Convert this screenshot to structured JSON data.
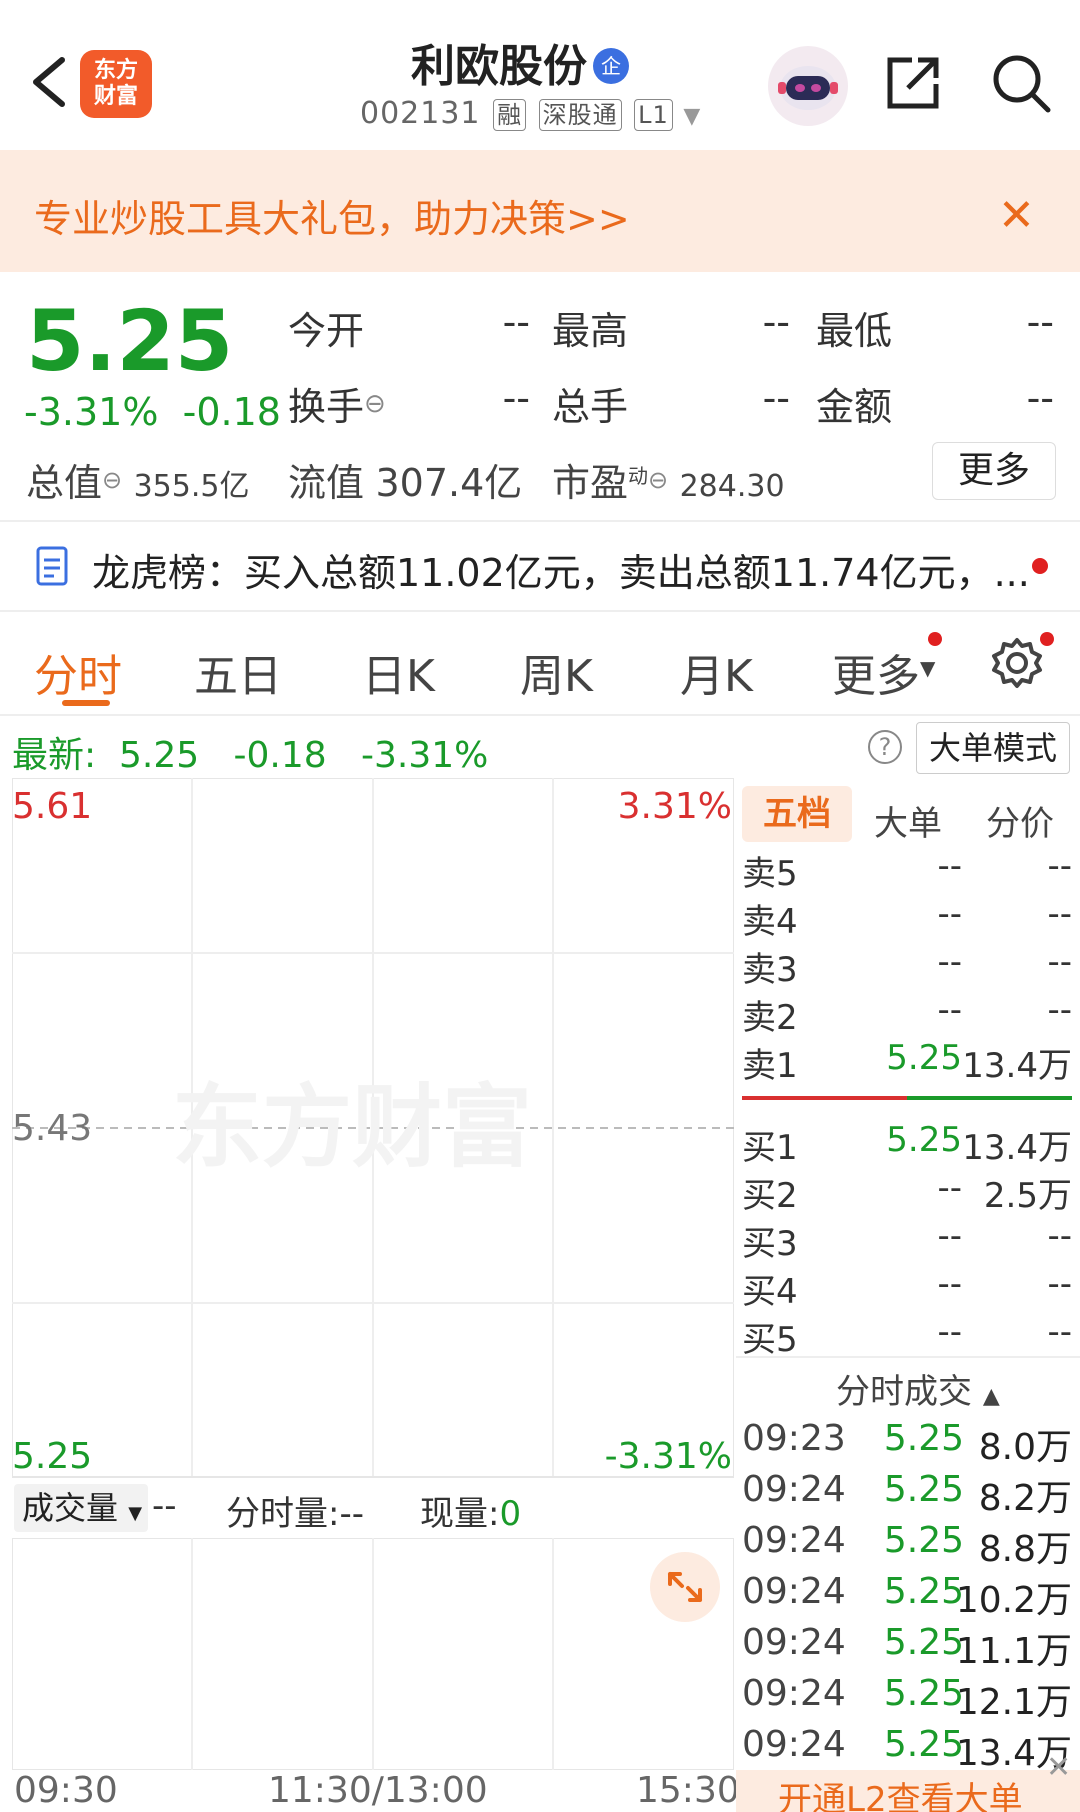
{
  "header": {
    "stock_name": "利欧股份",
    "enterprise_badge": "企",
    "stock_code": "002131",
    "tags": [
      "融",
      "深股通",
      "L1"
    ],
    "logo_text": [
      "东方",
      "财富"
    ]
  },
  "banner": {
    "text": "专业炒股工具大礼包，助力决策>>",
    "close": "✕"
  },
  "quote": {
    "price": "5.25",
    "change_pct": "-3.31%",
    "change_amt": "-0.18",
    "open_label": "今开",
    "open_value": "--",
    "high_label": "最高",
    "high_value": "--",
    "low_label": "最低",
    "low_value": "--",
    "turnover_label": "换手",
    "turnover_value": "--",
    "volume_label": "总手",
    "volume_value": "--",
    "amount_label": "金额",
    "amount_value": "--",
    "market_cap_label": "总值",
    "market_cap_value": "355.5亿",
    "float_cap_label": "流值",
    "float_cap_value": "307.4亿",
    "pe_label": "市盈",
    "pe_superscript": "动",
    "pe_value": "284.30",
    "more_button": "更多"
  },
  "dragon_tiger": {
    "text": "龙虎榜：买入总额11.02亿元，卖出总额11.74亿元，..."
  },
  "tabs": [
    {
      "label": "分时",
      "active": true
    },
    {
      "label": "五日",
      "active": false
    },
    {
      "label": "日K",
      "active": false
    },
    {
      "label": "周K",
      "active": false
    },
    {
      "label": "月K",
      "active": false
    },
    {
      "label": "更多",
      "active": false
    }
  ],
  "latest": {
    "label": "最新:",
    "price": "5.25",
    "change": "-0.18",
    "pct": "-3.31%",
    "help": "?",
    "big_order_mode": "大单模式"
  },
  "chart_data": {
    "type": "line",
    "y_left_ticks": [
      "5.61",
      "5.43",
      "5.25"
    ],
    "y_right_ticks": [
      "3.31%",
      "-3.31%"
    ],
    "x_ticks": [
      "09:30",
      "11:30/13:00",
      "15:30"
    ],
    "watermark": "东方财富",
    "series": []
  },
  "order_book": {
    "tabs": [
      "五档",
      "大单",
      "分价"
    ],
    "asks": [
      {
        "label": "卖5",
        "price": "--",
        "volume": "--"
      },
      {
        "label": "卖4",
        "price": "--",
        "volume": "--"
      },
      {
        "label": "卖3",
        "price": "--",
        "volume": "--"
      },
      {
        "label": "卖2",
        "price": "--",
        "volume": "--"
      },
      {
        "label": "卖1",
        "price": "5.25",
        "volume": "13.4万"
      }
    ],
    "bids": [
      {
        "label": "买1",
        "price": "5.25",
        "volume": "13.4万"
      },
      {
        "label": "买2",
        "price": "--",
        "volume": "2.5万"
      },
      {
        "label": "买3",
        "price": "--",
        "volume": "--"
      },
      {
        "label": "买4",
        "price": "--",
        "volume": "--"
      },
      {
        "label": "买5",
        "price": "--",
        "volume": "--"
      }
    ]
  },
  "ticks": {
    "title": "分时成交",
    "rows": [
      {
        "time": "09:23",
        "price": "5.25",
        "volume": "8.0万"
      },
      {
        "time": "09:24",
        "price": "5.25",
        "volume": "8.2万"
      },
      {
        "time": "09:24",
        "price": "5.25",
        "volume": "8.8万"
      },
      {
        "time": "09:24",
        "price": "5.25",
        "volume": "10.2万"
      },
      {
        "time": "09:24",
        "price": "5.25",
        "volume": "11.1万"
      },
      {
        "time": "09:24",
        "price": "5.25",
        "volume": "12.1万"
      },
      {
        "time": "09:24",
        "price": "5.25",
        "volume": "13.4万"
      }
    ]
  },
  "volume_bar": {
    "selector": "成交量",
    "selector_value": "--",
    "period_label": "分时量:",
    "period_value": "--",
    "current_label": "现量:",
    "current_value": "0"
  },
  "bottom": {
    "l2_text": "开通L2查看大单"
  },
  "colors": {
    "accent": "#ea6a1c",
    "down": "#1a9a2a",
    "up": "#d93030"
  }
}
